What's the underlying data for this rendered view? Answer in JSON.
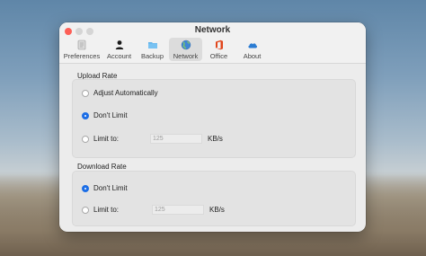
{
  "window": {
    "title": "Network"
  },
  "toolbar": {
    "items": [
      {
        "label": "Preferences",
        "icon": "preferences-icon"
      },
      {
        "label": "Account",
        "icon": "account-icon"
      },
      {
        "label": "Backup",
        "icon": "folder-icon"
      },
      {
        "label": "Network",
        "icon": "globe-icon",
        "selected": true
      },
      {
        "label": "Office",
        "icon": "office-icon"
      },
      {
        "label": "About",
        "icon": "cloud-icon"
      }
    ]
  },
  "upload": {
    "title": "Upload Rate",
    "adjust_label": "Adjust Automatically",
    "dont_limit_label": "Don't Limit",
    "limit_label": "Limit to:",
    "limit_value": "125",
    "unit": "KB/s",
    "selected": "dont_limit"
  },
  "download": {
    "title": "Download Rate",
    "dont_limit_label": "Don't Limit",
    "limit_label": "Limit to:",
    "limit_value": "125",
    "unit": "KB/s",
    "selected": "dont_limit"
  },
  "colors": {
    "accent": "#1d6ee6",
    "close": "#fd5f57",
    "office": "#e1451b",
    "cloud": "#2b7cd3"
  }
}
